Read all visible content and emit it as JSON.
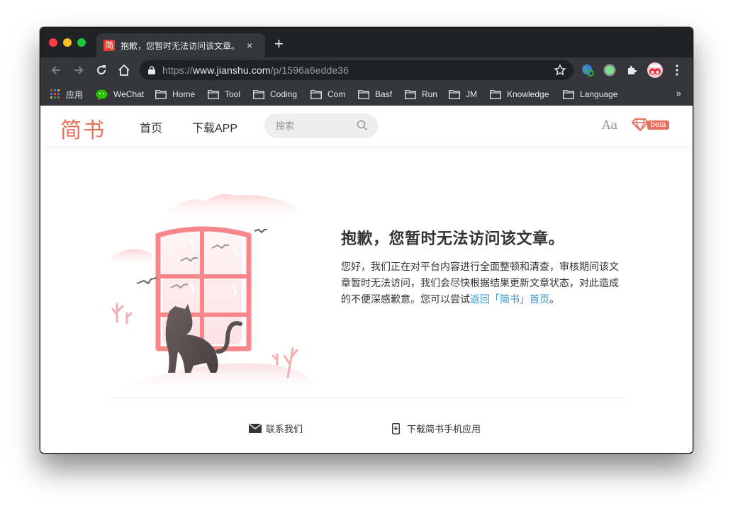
{
  "browser": {
    "tab": {
      "favicon_glyph": "简",
      "title": "抱歉，您暂时无法访问该文章。 - 简书",
      "close_icon": "×"
    },
    "new_tab_icon": "+",
    "url": {
      "scheme": "https://",
      "host": "www.jianshu.com",
      "path": "/p/1596a6edde36"
    },
    "toolbar_icons": [
      "back-icon",
      "forward-icon",
      "reload-icon",
      "home-icon",
      "lock-icon",
      "star-icon",
      "extension-globe-icon",
      "extension-circle-icon",
      "extensions-puzzle-icon",
      "profile-avatar",
      "menu-icon"
    ],
    "bookmarks": [
      {
        "label": "应用",
        "icon": "apps-grid-icon"
      },
      {
        "label": "WeChat",
        "icon": "wechat-icon"
      },
      {
        "label": "Home",
        "icon": "folder-icon"
      },
      {
        "label": "Tool",
        "icon": "folder-icon"
      },
      {
        "label": "Coding",
        "icon": "folder-icon"
      },
      {
        "label": "Com",
        "icon": "folder-icon"
      },
      {
        "label": "Basf",
        "icon": "folder-icon"
      },
      {
        "label": "Run",
        "icon": "folder-icon"
      },
      {
        "label": "JM",
        "icon": "folder-icon"
      },
      {
        "label": "Knowledge",
        "icon": "folder-icon"
      },
      {
        "label": "Language",
        "icon": "folder-icon"
      }
    ],
    "bookmarks_more": "»"
  },
  "site": {
    "logo": "简书",
    "nav": {
      "home": "首页",
      "download_app": "下载APP"
    },
    "search": {
      "placeholder": "搜索",
      "value": ""
    },
    "font_toggle": "Aa",
    "beta_label": "beta",
    "brand_color": "#ea6f5a",
    "link_color": "#3194d0"
  },
  "error": {
    "title": "抱歉，您暂时无法访问该文章。",
    "body_text": "您好，我们正在对平台内容进行全面整顿和清查，审核期间该文章暂时无法访问，我们会尽快根据结果更新文章状态，对此造成的不便深感歉意。您可以尝试",
    "link_text": "返回「简书」首页",
    "body_end": "。"
  },
  "footer": {
    "contact": "联系我们",
    "download_mobile": "下载简书手机应用"
  }
}
